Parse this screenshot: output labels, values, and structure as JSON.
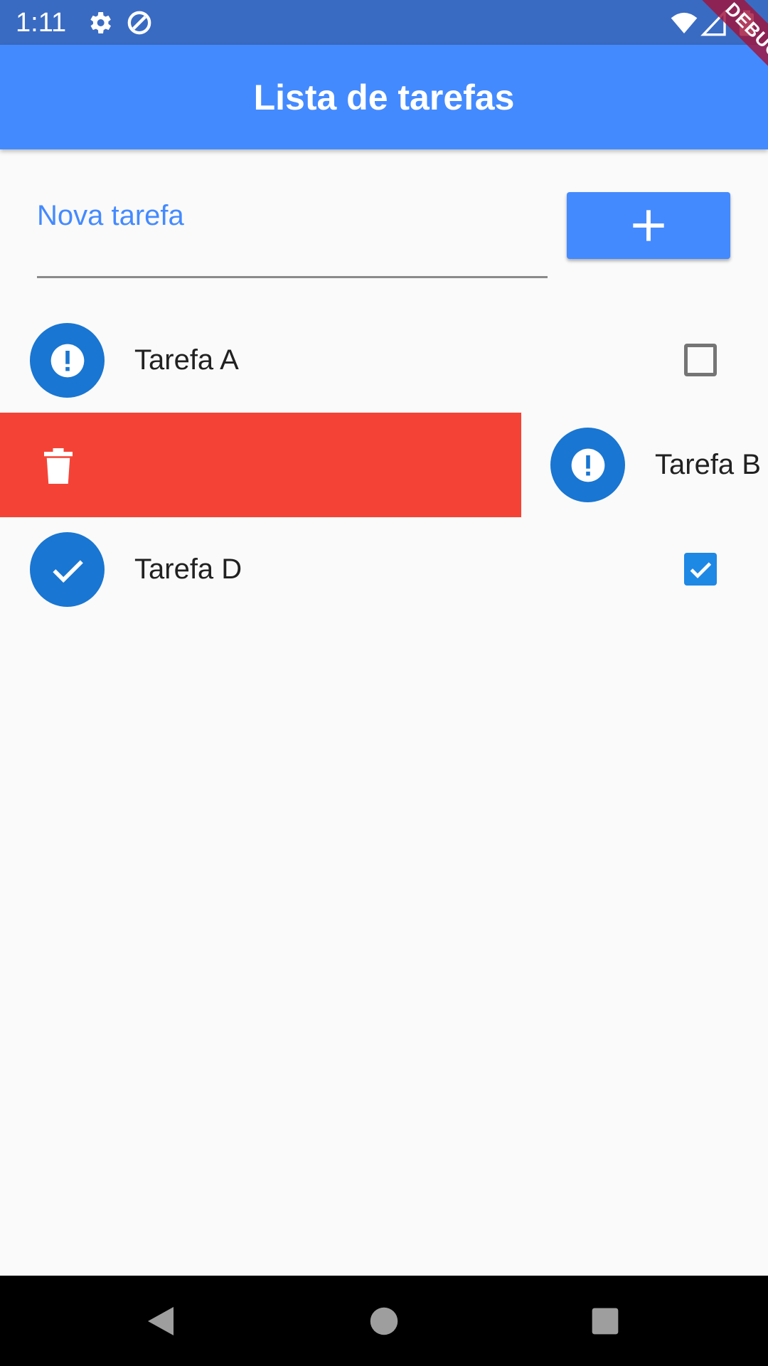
{
  "status_bar": {
    "time": "1:11",
    "icons": [
      "gear-icon",
      "no-sync-icon",
      "wifi-icon",
      "signal-icon",
      "battery-icon"
    ],
    "background": "#3a6bc3"
  },
  "debug_banner": {
    "label": "DEBUG"
  },
  "app_bar": {
    "title": "Lista de tarefas",
    "color": "#448aff"
  },
  "new_task": {
    "label": "Nova tarefa",
    "value": ""
  },
  "add_button": {
    "icon": "plus-icon"
  },
  "tasks": [
    {
      "title": "Tarefa A",
      "icon": "error-icon",
      "checked": false
    },
    {
      "title": "Tarefa B",
      "icon": "error-icon",
      "checked": false,
      "dismiss_icon": "trash-icon"
    },
    {
      "title": "Tarefa D",
      "icon": "check-icon",
      "checked": true
    }
  ],
  "colors": {
    "accent": "#448aff",
    "avatar": "#1976d2",
    "delete": "#f44336",
    "checkbox": "#1e88e5"
  },
  "nav_bar": {
    "buttons": [
      "back-icon",
      "home-icon",
      "recents-icon"
    ]
  }
}
